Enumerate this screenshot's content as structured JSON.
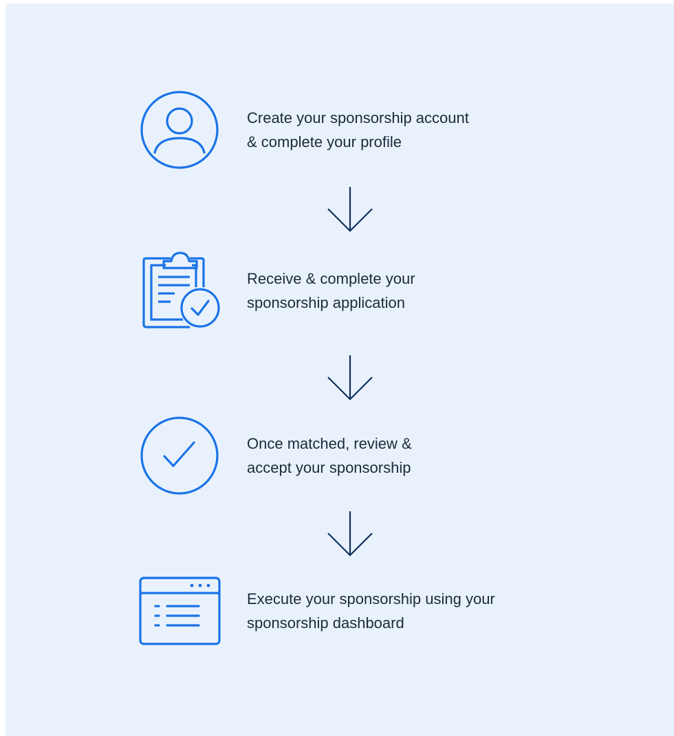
{
  "colors": {
    "panel_background": "#e9f2fc",
    "icon_blue": "#1a73e8",
    "arrow_navy": "#0f2e5a",
    "text": "#1b2a3a"
  },
  "steps": [
    {
      "icon": "user-profile-icon",
      "lines": [
        "Create your sponsorship account",
        "& complete your profile"
      ]
    },
    {
      "icon": "clipboard-check-icon",
      "lines": [
        "Receive & complete your",
        "sponsorship application"
      ]
    },
    {
      "icon": "check-circle-icon",
      "lines": [
        "Once matched, review &",
        "accept your sponsorship"
      ]
    },
    {
      "icon": "dashboard-window-icon",
      "lines": [
        "Execute your sponsorship using your",
        "sponsorship dashboard"
      ]
    }
  ],
  "connectors": [
    "arrow-down-icon",
    "arrow-down-icon",
    "arrow-down-icon"
  ]
}
